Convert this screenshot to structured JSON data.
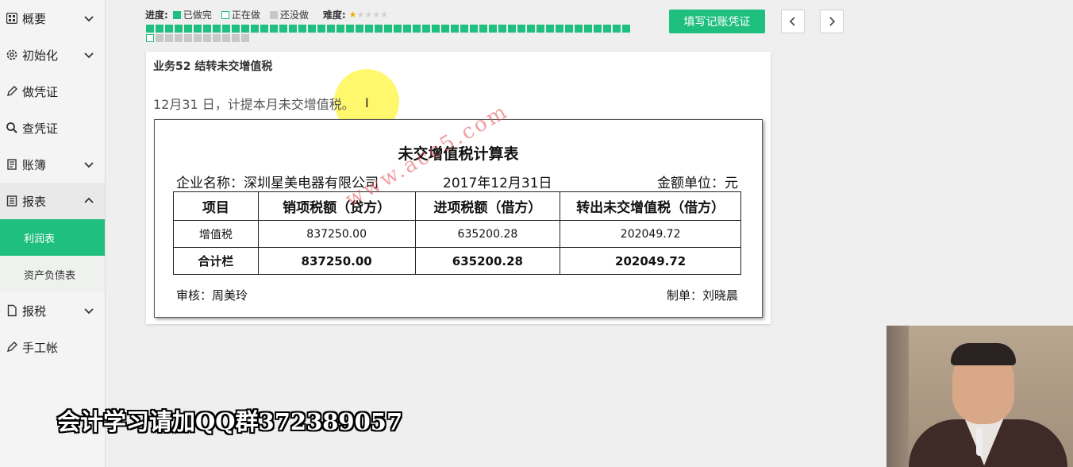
{
  "sidebar": {
    "items": [
      {
        "label": "概要",
        "icon": "grid-icon",
        "expanded": false
      },
      {
        "label": "初始化",
        "icon": "gear-icon",
        "expanded": false
      },
      {
        "label": "做凭证",
        "icon": "pen-icon"
      },
      {
        "label": "查凭证",
        "icon": "search-icon"
      },
      {
        "label": "账簿",
        "icon": "book-icon",
        "expanded": false
      },
      {
        "label": "报表",
        "icon": "report-icon",
        "expanded": true
      },
      {
        "label": "报税",
        "icon": "file-icon",
        "expanded": false
      },
      {
        "label": "手工帐",
        "icon": "pen-icon"
      }
    ],
    "sub_items": [
      {
        "label": "利润表",
        "active": true
      },
      {
        "label": "资产负债表",
        "active": false
      }
    ]
  },
  "progress": {
    "label": "进度:",
    "legend_done": "已做完",
    "legend_doing": "正在做",
    "legend_todo": "还没做",
    "difficulty_label": "难度:",
    "difficulty_stars": 1,
    "difficulty_max": 5,
    "done_count": 51,
    "doing_count": 1,
    "todo_count": 10
  },
  "toolbar": {
    "fill_voucher_label": "填写记账凭证"
  },
  "task": {
    "title": "业务52 结转未交增值税",
    "description": "12月31 日，计提本月未交增值税。"
  },
  "document": {
    "title": "未交增值税计算表",
    "company": "企业名称：深圳星美电器有限公司",
    "date": "2017年12月31日",
    "unit": "金额单位：元",
    "headers": [
      "项目",
      "销项税额（贷方）",
      "进项税额（借方）",
      "转出未交增值税（借方）"
    ],
    "rows": [
      [
        "增值税",
        "837250.00",
        "635200.28",
        "202049.72"
      ]
    ],
    "total_row": [
      "合计栏",
      "837250.00",
      "635200.28",
      "202049.72"
    ],
    "auditor": "审核：周美玲",
    "maker": "制单：刘晓晨",
    "watermark": "www.acc5.com"
  },
  "caption": "会计学习请加QQ群372389057",
  "colors": {
    "accent": "#1fbf7f",
    "todo": "#c8c8c8",
    "star": "#f0b000"
  }
}
